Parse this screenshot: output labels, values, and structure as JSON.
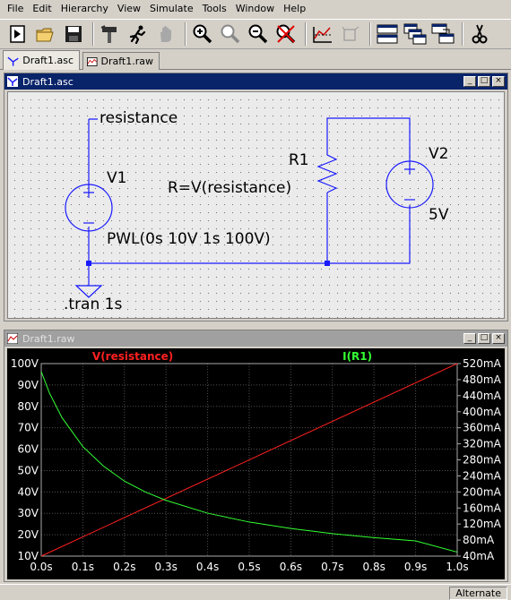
{
  "menubar": {
    "items": [
      "File",
      "Edit",
      "Hierarchy",
      "View",
      "Simulate",
      "Tools",
      "Window",
      "Help"
    ]
  },
  "toolbar": {
    "buttons": [
      "new-schematic",
      "open",
      "save",
      "control-panel",
      "run",
      "halt",
      "zoom-in",
      "pan",
      "zoom-out",
      "cancel-zoom",
      "autorange",
      "fit",
      "tile-horizontal",
      "cascade",
      "tile-vertical",
      "cut"
    ]
  },
  "tabs": [
    {
      "label": "Draft1.asc",
      "active": true
    },
    {
      "label": "Draft1.raw",
      "active": false
    }
  ],
  "schematic": {
    "title": "Draft1.asc",
    "labels": {
      "net": "resistance",
      "v1": "V1",
      "v1_value": "PWL(0s 10V 1s 100V)",
      "r1": "R1",
      "r1_value": "R=V(resistance)",
      "v2": "V2",
      "v2_value": "5V",
      "directive": ".tran 1s"
    }
  },
  "waveform": {
    "title": "Draft1.raw"
  },
  "chart_data": {
    "type": "line",
    "x_ticks": [
      "0.0s",
      "0.1s",
      "0.2s",
      "0.3s",
      "0.4s",
      "0.5s",
      "0.6s",
      "0.7s",
      "0.8s",
      "0.9s",
      "1.0s"
    ],
    "xlim": [
      0,
      1
    ],
    "left_ticks": [
      "10V",
      "20V",
      "30V",
      "40V",
      "50V",
      "60V",
      "70V",
      "80V",
      "90V",
      "100V"
    ],
    "left_lim": [
      10,
      100
    ],
    "right_ticks": [
      "40mA",
      "80mA",
      "120mA",
      "160mA",
      "200mA",
      "240mA",
      "280mA",
      "320mA",
      "360mA",
      "400mA",
      "440mA",
      "480mA",
      "520mA"
    ],
    "right_lim": [
      40,
      520
    ],
    "grid": true,
    "series": [
      {
        "name": "V(resistance)",
        "axis": "left",
        "color": "#ff2020",
        "x": [
          0,
          1
        ],
        "y": [
          10,
          100
        ]
      },
      {
        "name": "I(R1)",
        "axis": "right",
        "color": "#33ff33",
        "x": [
          0,
          0.02,
          0.05,
          0.1,
          0.15,
          0.2,
          0.25,
          0.3,
          0.4,
          0.5,
          0.6,
          0.7,
          0.8,
          0.9,
          1.0
        ],
        "y": [
          500,
          446,
          385,
          313,
          264,
          227,
          200,
          179,
          147,
          125,
          109,
          96,
          86,
          78,
          50
        ]
      }
    ]
  },
  "statusbar": {
    "mode": "Alternate"
  },
  "colors": {
    "window_bg": "#d4d0c8",
    "titlebar_active": "#0a246a",
    "wire": "#1a1aff",
    "component": "#1a1aff",
    "plot_bg": "#000000",
    "grid": "#505050",
    "axis_label": "#ffffff"
  }
}
